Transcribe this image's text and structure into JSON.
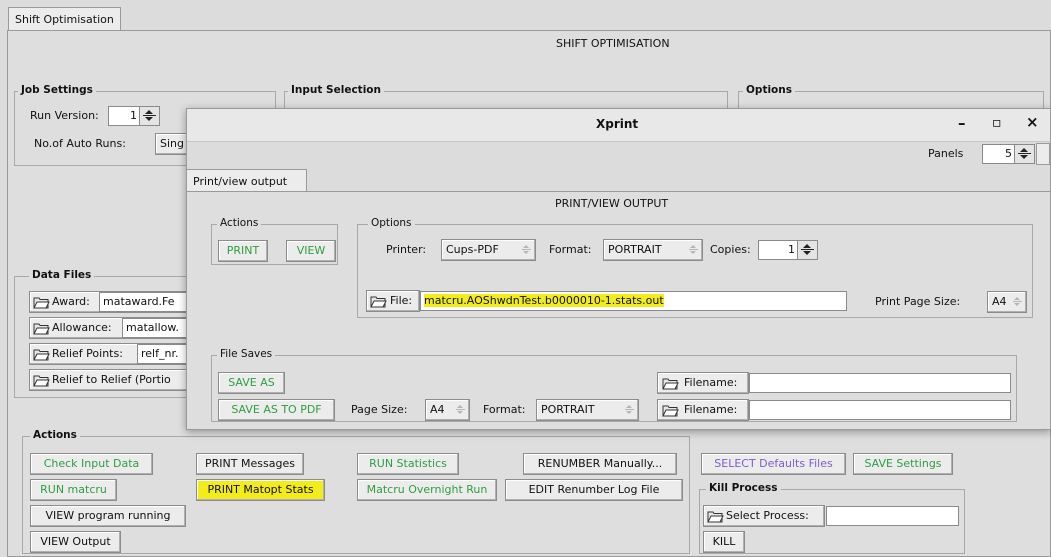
{
  "main": {
    "tab_label": "Shift Optimisation",
    "header": "SHIFT OPTIMISATION",
    "job_settings": {
      "title": "Job Settings",
      "run_version_label": "Run Version:",
      "run_version_value": "1",
      "auto_runs_label": "No.of Auto Runs:",
      "auto_runs_value": "Sing"
    },
    "input_selection_title": "Input Selection",
    "options_title": "Options",
    "data_files": {
      "title": "Data Files",
      "award_label": "Award:",
      "award_value": "mataward.Fe",
      "allowance_label": "Allowance:",
      "allowance_value": "matallow.",
      "relief_points_label": "Relief Points:",
      "relief_points_value": "relf_nr.",
      "relief_to_relief_label": "Relief to Relief (Portio"
    },
    "actions": {
      "title": "Actions",
      "check_input": "Check Input Data",
      "run_matcru": "RUN matcru",
      "view_running": "VIEW program running",
      "view_output": "VIEW Output",
      "print_messages": "PRINT Messages",
      "print_matopt_stats": "PRINT Matopt Stats",
      "run_statistics": "RUN Statistics",
      "overnight_run": "Matcru Overnight Run",
      "renumber_manually": "RENUMBER Manually...",
      "edit_renumber_log": "EDIT Renumber Log File",
      "select_defaults": "SELECT Defaults Files",
      "save_settings": "SAVE Settings"
    },
    "kill_process": {
      "title": "Kill Process",
      "select_label": "Select Process:",
      "select_value": "",
      "kill_button": "KILL"
    }
  },
  "xprint": {
    "title": "Xprint",
    "minimize": "–",
    "maximize": "▫",
    "close": "×",
    "panels_label": "Panels",
    "panels_value": "5",
    "tab_label": "Print/view output",
    "header": "PRINT/VIEW OUTPUT",
    "actions": {
      "title": "Actions",
      "print": "PRINT",
      "view": "VIEW"
    },
    "options": {
      "title": "Options",
      "printer_label": "Printer:",
      "printer_value": "Cups-PDF",
      "format_label": "Format:",
      "format_value": "PORTRAIT",
      "copies_label": "Copies:",
      "copies_value": "1",
      "file_label": "File:",
      "file_value": "matcru.AOShwdnTest.b0000010-1.stats.out",
      "page_size_label": "Print Page Size:",
      "page_size_value": "A4"
    },
    "file_saves": {
      "title": "File Saves",
      "save_as": "SAVE AS",
      "save_as_pdf": "SAVE AS TO PDF",
      "page_size_label": "Page Size:",
      "page_size_value": "A4",
      "format_label": "Format:",
      "format_value": "PORTRAIT",
      "filename_label_1": "Filename:",
      "filename_value_1": "",
      "filename_label_2": "Filename:",
      "filename_value_2": ""
    }
  },
  "colors": {
    "green_action": "#2e9e3e",
    "purple_action": "#7d5dc8",
    "highlight": "#f3ec1a"
  },
  "icons": [
    "folder-open-icon",
    "spin-arrows-icon",
    "combo-arrows-icon",
    "minimize-icon",
    "maximize-icon",
    "close-icon"
  ]
}
